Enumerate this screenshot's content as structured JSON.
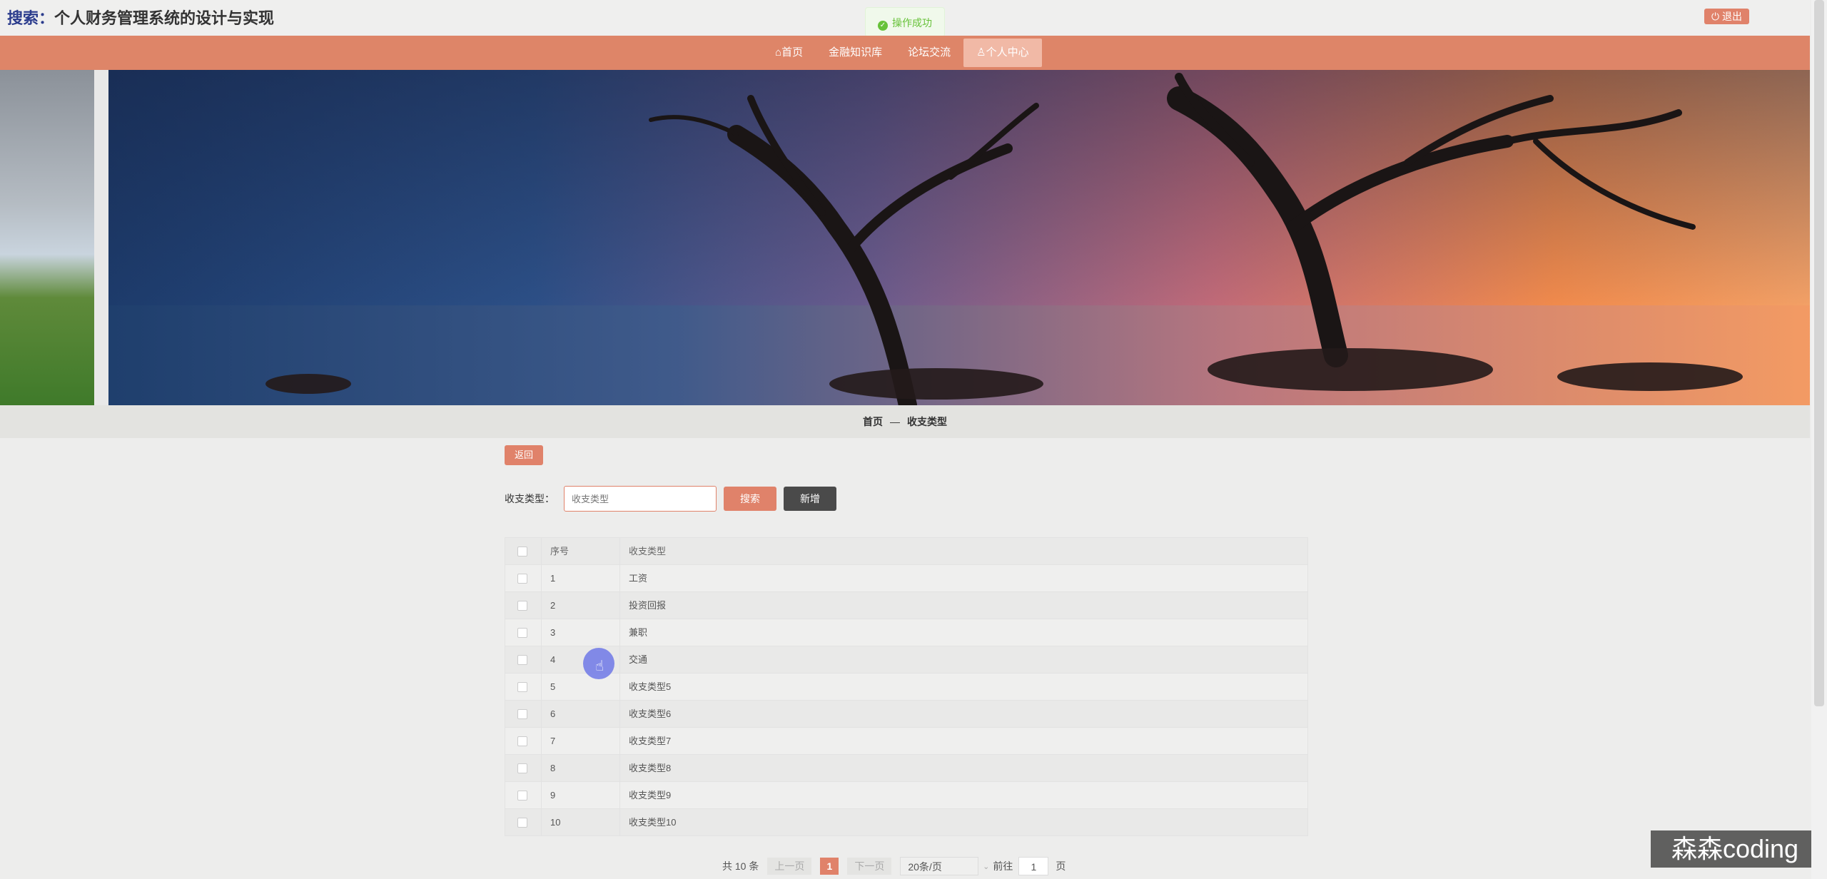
{
  "header": {
    "title": "个人财务管理系统的设计与实现",
    "overlay": "搜索：",
    "logout_label": "退出"
  },
  "toast": {
    "message": "操作成功"
  },
  "nav": {
    "items": [
      {
        "label": "首页",
        "icon": "home-icon"
      },
      {
        "label": "金融知识库"
      },
      {
        "label": "论坛交流"
      },
      {
        "label": "个人中心",
        "icon": "user-icon",
        "active": true
      }
    ]
  },
  "breadcrumb": {
    "home": "首页",
    "separator": "—",
    "current": "收支类型"
  },
  "toolbar": {
    "back_label": "返回",
    "search_label": "收支类型：",
    "search_placeholder": "收支类型",
    "search_button": "搜索",
    "add_button": "新增"
  },
  "table": {
    "columns": [
      "序号",
      "收支类型"
    ],
    "rows": [
      {
        "no": "1",
        "type": "工资"
      },
      {
        "no": "2",
        "type": "投资回报"
      },
      {
        "no": "3",
        "type": "兼职"
      },
      {
        "no": "4",
        "type": "交通"
      },
      {
        "no": "5",
        "type": "收支类型5"
      },
      {
        "no": "6",
        "type": "收支类型6"
      },
      {
        "no": "7",
        "type": "收支类型7"
      },
      {
        "no": "8",
        "type": "收支类型8"
      },
      {
        "no": "9",
        "type": "收支类型9"
      },
      {
        "no": "10",
        "type": "收支类型10"
      }
    ]
  },
  "pagination": {
    "total": "共 10 条",
    "prev": "上一页",
    "current": "1",
    "next": "下一页",
    "page_size": "20条/页",
    "goto_label": "前往",
    "goto_value": "1",
    "page_unit": "页"
  },
  "watermark": "森森coding",
  "colors": {
    "accent": "#de8568",
    "dark_button": "#4a4a4a",
    "success": "#67c23a"
  }
}
